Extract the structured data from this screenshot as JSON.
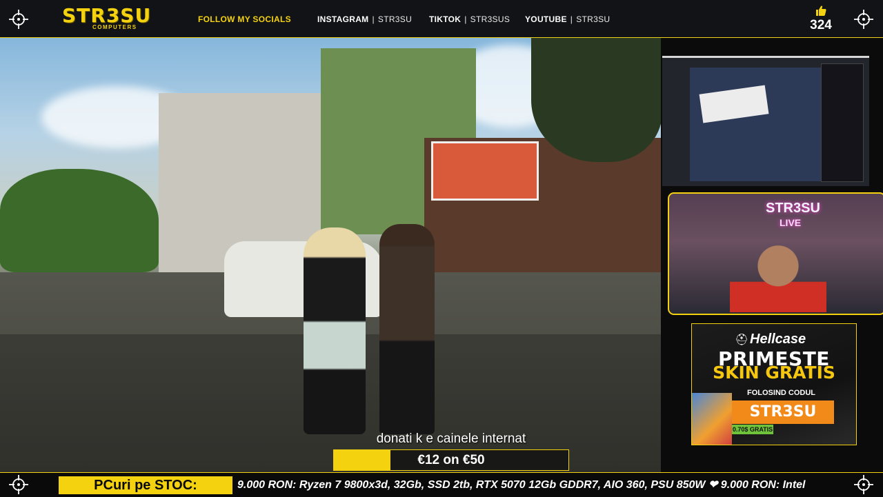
{
  "header": {
    "logo_text": "STR3SU",
    "logo_subtext": "COMPUTERS",
    "follow_label": "FOLLOW MY SOCIALS",
    "socials": [
      {
        "platform": "INSTAGRAM",
        "handle": "STR3SU"
      },
      {
        "platform": "TIKTOK",
        "handle": "STR3SUS"
      },
      {
        "platform": "YOUTUBE",
        "handle": "STR3SU"
      }
    ],
    "separator": "|",
    "likes_icon": "thumbs-up-icon",
    "likes_count": "324"
  },
  "video": {
    "caption": "donati k e cainele internat",
    "goal_text": "€12 on €50",
    "goal_progress": 0.24
  },
  "webcam": {
    "neon_line1": "STR3SU",
    "neon_line2": "LIVE"
  },
  "ad": {
    "brand": "Hellcase",
    "line1": "PRIMESTE",
    "line2": "SKIN GRATIS",
    "line3": "FOLOSIND CODUL",
    "code": "STR3SU",
    "bonus": "0.70$ GRATIS"
  },
  "ticker": {
    "label": "PCuri pe STOC:",
    "text": "9.000 RON: Ryzen 7 9800x3d, 32Gb, SSD 2tb, RTX 5070 12Gb GDDR7, AIO 360, PSU 850W ❤ 9.000 RON: Intel"
  },
  "colors": {
    "accent": "#f5d20f",
    "topbar": "#14161c",
    "ad_code": "#f28a1a"
  }
}
